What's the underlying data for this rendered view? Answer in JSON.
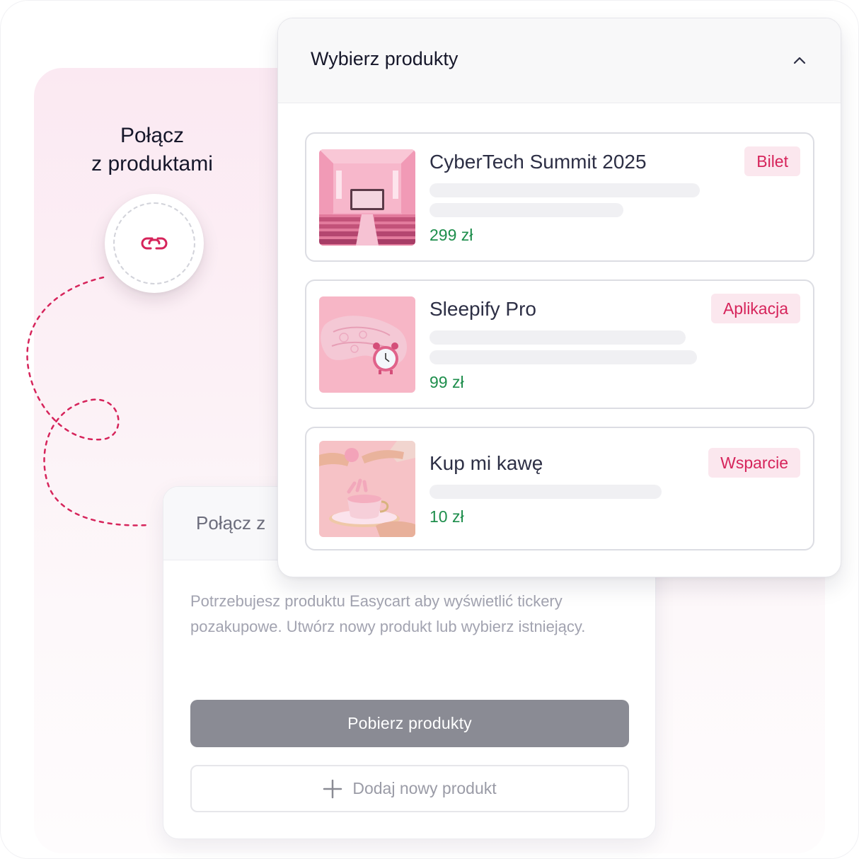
{
  "connect": {
    "title_line1": "Połącz",
    "title_line2": "z produktami"
  },
  "background_card": {
    "title": "Połącz z",
    "description": "Potrzebujesz produktu Easycart aby wyświetlić tickery pozakupowe. Utwórz nowy produkt lub wybierz istniejący.",
    "fetch_button": "Pobierz produkty",
    "add_button": "Dodaj nowy produkt"
  },
  "dropdown": {
    "title": "Wybierz produkty",
    "products": [
      {
        "name": "CyberTech Summit 2025",
        "badge": "Bilet",
        "price": "299 zł",
        "image": "conference-hall-image"
      },
      {
        "name": "Sleepify Pro",
        "badge": "Aplikacja",
        "price": "99 zł",
        "image": "sleep-mask-clock-image"
      },
      {
        "name": "Kup mi kawę",
        "badge": "Wsparcie",
        "price": "10 zł",
        "image": "coffee-cup-image"
      }
    ]
  },
  "colors": {
    "accent": "#d6245b",
    "price": "#1e8e4c",
    "badge_bg": "#fbe7ee",
    "fetch_button_bg": "#8a8b94"
  },
  "icons": [
    "link-icon",
    "chevron-up-icon",
    "plus-icon"
  ]
}
